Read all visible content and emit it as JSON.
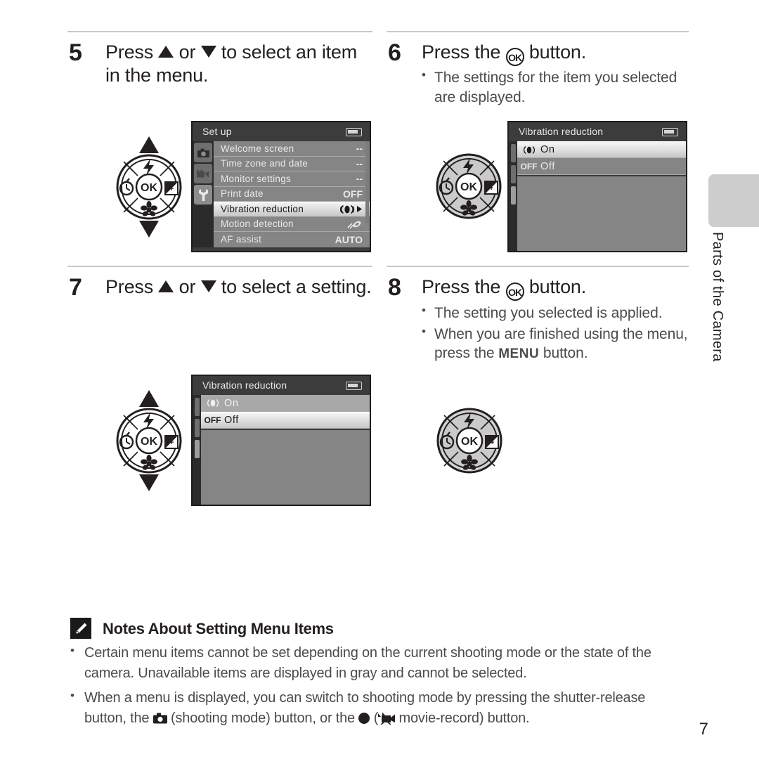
{
  "side_tab": {
    "label": "Parts of the Camera"
  },
  "page_number": "7",
  "steps": [
    {
      "num": "5",
      "head_pre": "Press ",
      "head_mid": " or ",
      "head_post": " to select an item in the menu."
    },
    {
      "num": "6",
      "head_pre": "Press the ",
      "head_ok": "OK",
      "head_post": " button.",
      "bullets": [
        "The settings for the item you selected are displayed."
      ]
    },
    {
      "num": "7",
      "head_pre": "Press ",
      "head_mid": " or ",
      "head_post": " to select a setting."
    },
    {
      "num": "8",
      "head_pre": "Press the ",
      "head_ok": "OK",
      "head_post": " button.",
      "bullets": [
        "The setting you selected is applied.",
        "When you are finished using the menu, press the MENU button."
      ],
      "bullet2_pre": "When you are finished using the menu, press the ",
      "bullet2_menu": "MENU",
      "bullet2_post": " button."
    }
  ],
  "setup_screen": {
    "title": "Set up",
    "tabs": [
      "camera-icon",
      "movie-icon",
      "wrench-icon"
    ],
    "selected_tab": 2,
    "rows": [
      {
        "label": "Welcome screen",
        "value": "--",
        "selected": false
      },
      {
        "label": "Time zone and date",
        "value": "--",
        "selected": false
      },
      {
        "label": "Monitor settings",
        "value": "--",
        "selected": false
      },
      {
        "label": "Print date",
        "value": "OFF",
        "selected": false
      },
      {
        "label": "Vibration reduction",
        "value": "vr-icon",
        "selected": true
      },
      {
        "label": "Motion detection",
        "value": "motion-icon",
        "selected": false
      },
      {
        "label": "AF assist",
        "value": "AUTO",
        "selected": false
      }
    ]
  },
  "vr_screen_step6": {
    "title": "Vibration reduction",
    "options": [
      {
        "icon": "vr-icon",
        "label": "On",
        "selected": true
      },
      {
        "icon": "OFF",
        "label": "Off",
        "selected": false
      }
    ]
  },
  "vr_screen_step7": {
    "title": "Vibration reduction",
    "options": [
      {
        "icon": "vr-icon",
        "label": "On",
        "selected": false
      },
      {
        "icon": "OFF",
        "label": "Off",
        "selected": true
      }
    ]
  },
  "dial": {
    "center_label": "OK",
    "top_icon": "flash-icon",
    "left_icon": "self-timer-icon",
    "right_icon": "exposure-compensation-icon",
    "bottom_icon": "macro-icon"
  },
  "notes": {
    "title": "Notes About Setting Menu Items",
    "icon": "pencil-icon",
    "bullet1": "Certain menu items cannot be set depending on the current shooting mode or the state of the camera. Unavailable items are displayed in gray and cannot be selected.",
    "bullet2_a": "When a menu is displayed, you can switch to shooting mode by pressing the shutter-release button, the ",
    "bullet2_b": " (shooting mode) button, or the ",
    "bullet2_c": " (",
    "bullet2_d": " movie-record) button."
  },
  "colors": {
    "lcd_bg": "#3c3c3c",
    "lcd_row": "#858585",
    "lcd_highlight": "#e4e4e4",
    "text": "#231f20",
    "body_text": "#4b4b4b",
    "side_tab": "#cdcdcd"
  }
}
